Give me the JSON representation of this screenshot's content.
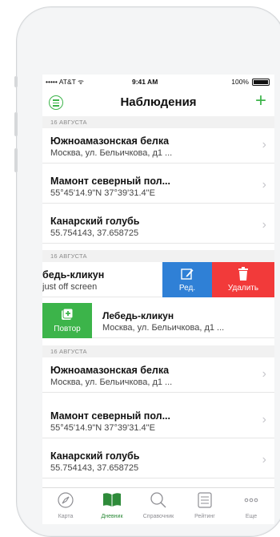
{
  "status_bar": {
    "carrier": "••••• AT&T ᯤ",
    "time": "9:41 AM",
    "battery": "100%"
  },
  "nav": {
    "title": "Наблюдения",
    "add_label": "+"
  },
  "sections": [
    "16 АВГУСТА",
    "16 АВГУСТА",
    "16 АВГУСТА"
  ],
  "rows_group1": [
    {
      "title": "Южноамазонская белка",
      "subtitle": "Москва, ул. Бельичкова, д1 ..."
    },
    {
      "title": "Мамонт северный пол...",
      "subtitle": "55°45'14.9\"N 37°39'31.4\"E"
    },
    {
      "title": "Канарский голубь",
      "subtitle": "55.754143, 37.658725"
    }
  ],
  "swipe_left_row": {
    "title": "бедь-кликун",
    "subtitle": "just off screen",
    "edit_label": "Ред.",
    "delete_label": "Удалить",
    "edit_color": "#2f80d6",
    "delete_color": "#f23a3a"
  },
  "swipe_right_row": {
    "repeat_label": "Повтор",
    "title": "Лебедь-кликун",
    "subtitle": "Москва, ул. Бельичкова, д1 ...",
    "repeat_color": "#3cb44a"
  },
  "rows_group3": [
    {
      "title": "Южноамазонская белка",
      "subtitle": "Москва, ул. Бельичкова, д1 ..."
    },
    {
      "title": "Мамонт северный пол...",
      "subtitle": "55°45'14.9\"N 37°39'31.4\"E"
    },
    {
      "title": "Канарский голубь",
      "subtitle": "55.754143, 37.658725"
    }
  ],
  "tabs": [
    {
      "label": "Карта",
      "icon": "compass-icon"
    },
    {
      "label": "Дневник",
      "icon": "book-icon",
      "active": true
    },
    {
      "label": "Справочник",
      "icon": "search-icon"
    },
    {
      "label": "Рейтинг",
      "icon": "list-icon"
    },
    {
      "label": "Еще",
      "icon": "more-icon"
    }
  ],
  "colors": {
    "accent": "#3cb44a",
    "active_tab": "#2e8b3a"
  }
}
